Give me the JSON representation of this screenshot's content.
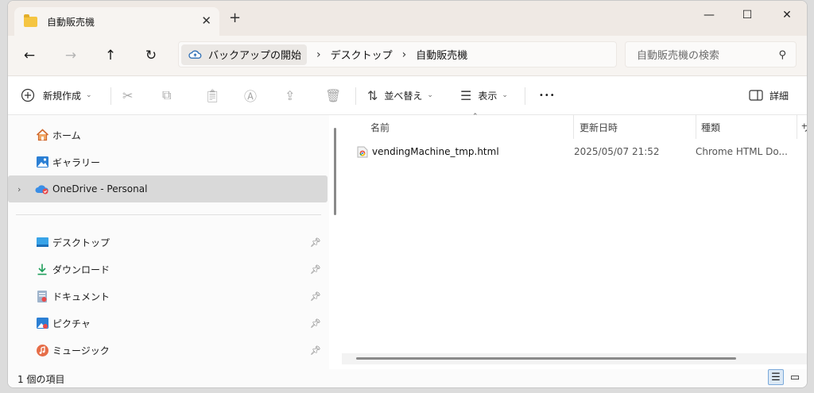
{
  "window": {
    "tab_title": "自動販売機",
    "tab_close": "✕",
    "new_tab": "+",
    "minimize": "—",
    "maximize": "☐",
    "close": "✕"
  },
  "nav": {
    "back": "←",
    "forward": "→",
    "up": "↑",
    "refresh": "↻",
    "breadcrumb": [
      "バックアップの開始",
      "デスクトップ",
      "自動販売機"
    ],
    "separator": "›",
    "search_placeholder": "自動販売機の検索"
  },
  "toolbar": {
    "new_label": "新規作成",
    "sort_label": "並べ替え",
    "view_label": "表示",
    "more_label": "•••",
    "details_label": "詳細"
  },
  "sidebar": {
    "items": [
      {
        "label": "ホーム",
        "icon": "home-icon"
      },
      {
        "label": "ギャラリー",
        "icon": "gallery-icon"
      },
      {
        "label": "OneDrive - Personal",
        "icon": "onedrive-icon"
      }
    ],
    "quick_access": [
      {
        "label": "デスクトップ",
        "icon": "desktop-icon"
      },
      {
        "label": "ダウンロード",
        "icon": "download-icon"
      },
      {
        "label": "ドキュメント",
        "icon": "documents-icon"
      },
      {
        "label": "ピクチャ",
        "icon": "pictures-icon"
      },
      {
        "label": "ミュージック",
        "icon": "music-icon"
      }
    ]
  },
  "columns": {
    "name": "名前",
    "modified": "更新日時",
    "type": "種類",
    "size": "サ"
  },
  "files": [
    {
      "name": "vendingMachine_tmp.html",
      "modified": "2025/05/07 21:52",
      "type": "Chrome HTML Do..."
    }
  ],
  "status": {
    "count": "1 個の項目"
  },
  "colors": {
    "accent": "#0067c0",
    "folder": "#f5c542",
    "selected": "#d9d9d9"
  }
}
